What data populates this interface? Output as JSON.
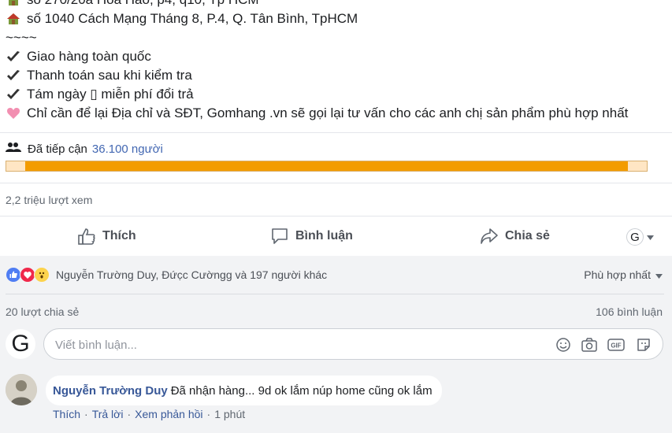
{
  "post": {
    "lines": [
      {
        "icon": "house-icon",
        "text": "số 270/20a Hoà Hảo, p4, q10, Tp HCM"
      },
      {
        "icon": "house-icon",
        "text": "số 1040 Cách Mạng Tháng 8, P.4, Q. Tân Bình, TpHCM"
      },
      {
        "icon": "",
        "text": "~~~~"
      },
      {
        "icon": "check-icon",
        "text": "Giao hàng toàn quốc"
      },
      {
        "icon": "check-icon",
        "text": "Thanh toán sau khi kiểm tra"
      },
      {
        "icon": "check-icon",
        "text": "Tám ngày ▯ miễn phí đổi trả"
      },
      {
        "icon": "heart-icon",
        "text": "Chỉ cần để lại Địa chỉ và SĐT, Gomhang .vn sẽ gọi lại tư vấn cho các anh chị sản phẩm phù hợp nhất"
      }
    ]
  },
  "reach": {
    "label": "Đã tiếp cận",
    "count": "36.100 người",
    "progress": 0.97,
    "color": "#f39c00"
  },
  "views": "2,2 triệu lượt xem",
  "actions": {
    "like": "Thích",
    "comment": "Bình luận",
    "share": "Chia sẻ",
    "avatar_letter": "G"
  },
  "reactions": {
    "names": "Nguyễn Trường Duy, Đức̣c Cườngg và 197 người khác",
    "sort": "Phù hợp nhất"
  },
  "shares": "20 lượt chia sẻ",
  "comments_count": "106 bình luận",
  "comment_box": {
    "avatar_letter": "G",
    "placeholder": "Viết bình luận..."
  },
  "comment": {
    "author": "Nguyễn Trường Duy",
    "text": "Đã nhận hàng... 9d ok lắm núp home cũng ok lắm",
    "like": "Thích",
    "reply": "Trả lời",
    "see_edits": "Xem phản hồi",
    "time": "1 phút"
  },
  "colors": {
    "accent": "#4267b2",
    "link": "#385898",
    "background_social": "#f2f3f5"
  }
}
